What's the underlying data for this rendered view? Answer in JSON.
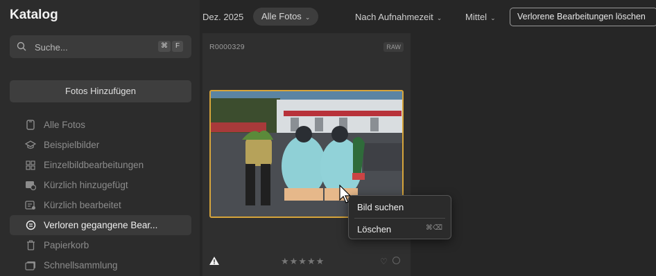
{
  "sidebar": {
    "title": "Katalog",
    "search": {
      "placeholder": "Suche...",
      "shortcut": [
        "⌘",
        "F"
      ]
    },
    "add_button": "Fotos Hinzufügen",
    "items": [
      {
        "label": "Alle Fotos",
        "icon": "phone-icon",
        "active": false
      },
      {
        "label": "Beispielbilder",
        "icon": "graduation-cap-icon",
        "active": false
      },
      {
        "label": "Einzelbildbearbeitungen",
        "icon": "grid-icon",
        "active": false
      },
      {
        "label": "Kürzlich hinzugefügt",
        "icon": "photo-clock-icon",
        "active": false
      },
      {
        "label": "Kürzlich bearbeitet",
        "icon": "photo-edit-icon",
        "active": false
      },
      {
        "label": "Verloren gegangene Bear...",
        "icon": "lost-edits-icon",
        "active": true
      },
      {
        "label": "Papierkorb",
        "icon": "trash-icon",
        "active": false
      },
      {
        "label": "Schnellsammlung",
        "icon": "quick-collection-icon",
        "active": false
      }
    ]
  },
  "topbar": {
    "date": "Dez. 2025",
    "filter": "Alle Fotos",
    "sort": "Nach Aufnahmezeit",
    "size": "Mittel",
    "action_button": "Verlorene Bearbeitungen löschen"
  },
  "card": {
    "filename": "R0000329",
    "badge": "RAW",
    "rating": "★★★★★",
    "fav": "♡"
  },
  "context_menu": {
    "items": [
      {
        "label": "Bild suchen",
        "shortcut": ""
      },
      {
        "label": "Löschen",
        "shortcut": "⌘⌫"
      }
    ]
  },
  "colors": {
    "accent_border": "#d7a53b",
    "background": "#262626",
    "sidebar": "#2c2c2c"
  }
}
